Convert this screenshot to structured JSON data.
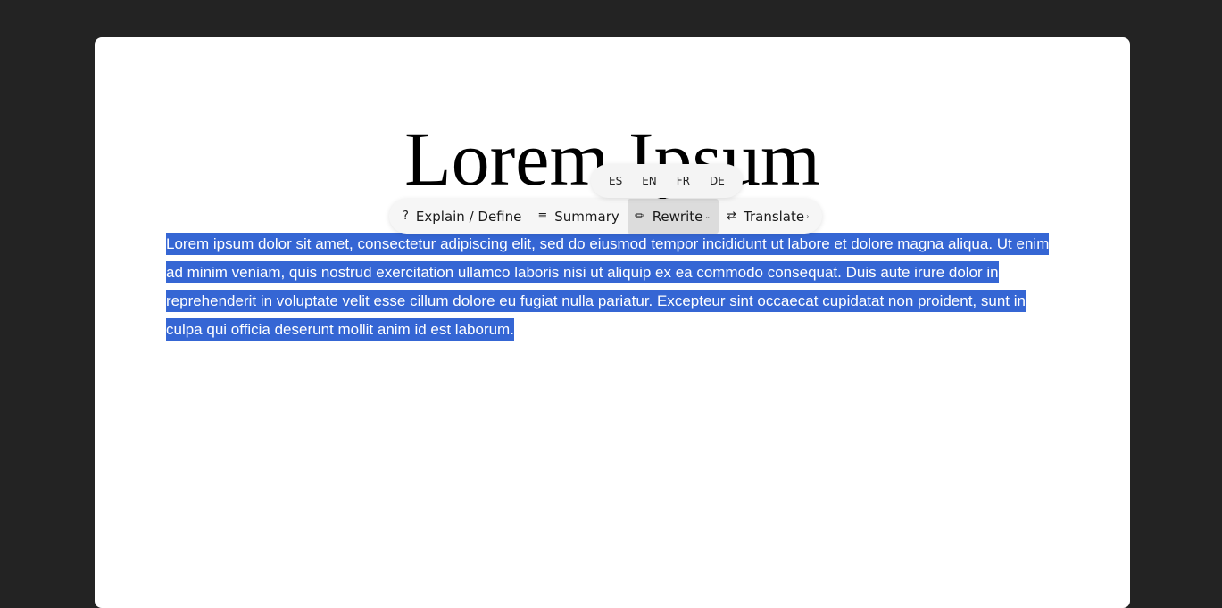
{
  "document": {
    "title": "Lorem Ipsum",
    "selected_text": "Lorem ipsum dolor sit amet, consectetur adipiscing elit, sed do eiusmod tempor incididunt ut labore et dolore magna aliqua. Ut enim ad minim veniam, quis nostrud exercitation ullamco laboris nisi ut aliquip ex ea commodo consequat. Duis aute irure dolor in reprehenderit in voluptate velit esse cillum dolore eu fugiat nulla pariatur. Excepteur sint occaecat cupidatat non proident, sunt in culpa qui officia deserunt mollit anim id est laborum."
  },
  "toolbar": {
    "explain": {
      "icon": "?",
      "label": "Explain / Define"
    },
    "summary": {
      "icon": "≡",
      "label": "Summary"
    },
    "rewrite": {
      "icon": "✎",
      "label": "Rewrite",
      "caret": "⌄"
    },
    "translate": {
      "icon": "⇄",
      "label": "Translate",
      "caret": "›"
    }
  },
  "language_menu": [
    "ES",
    "EN",
    "FR",
    "DE"
  ],
  "colors": {
    "background": "#232323",
    "page": "#ffffff",
    "selection": "#3566d4",
    "active_button": "#dcdcdc"
  }
}
